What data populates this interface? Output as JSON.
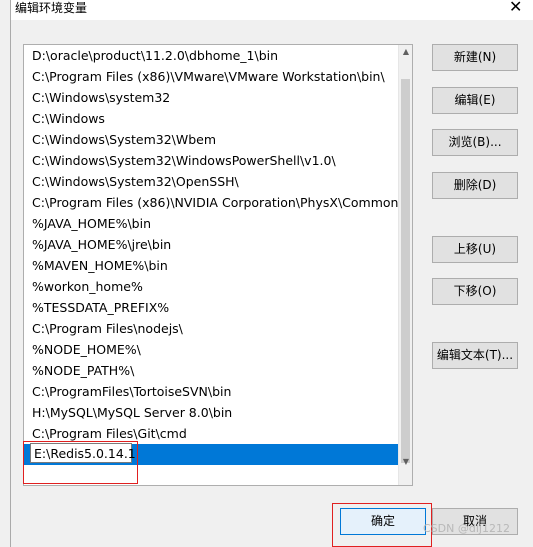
{
  "window": {
    "title": "编辑环境变量",
    "close_glyph": "✕"
  },
  "background_chars": [
    "变",
    "A",
    "C",
    "J",
    "M",
    "S",
    "T",
    "T",
    "U",
    "D",
    "",
    "",
    "",
    "",
    "",
    "",
    "",
    "",
    "",
    "",
    "",
    "",
    "",
    "",
    "",
    "",
    "",
    "",
    "",
    "",
    "",
    "",
    "",
    "",
    "",
    "",
    "",
    "",
    "",
    "",
    "",
    "",
    "",
    "",
    ""
  ],
  "path_entries": [
    "D:\\oracle\\product\\11.2.0\\dbhome_1\\bin",
    "C:\\Program Files (x86)\\VMware\\VMware Workstation\\bin\\",
    "C:\\Windows\\system32",
    "C:\\Windows",
    "C:\\Windows\\System32\\Wbem",
    "C:\\Windows\\System32\\WindowsPowerShell\\v1.0\\",
    "C:\\Windows\\System32\\OpenSSH\\",
    "C:\\Program Files (x86)\\NVIDIA Corporation\\PhysX\\Common",
    "%JAVA_HOME%\\bin",
    "%JAVA_HOME%\\jre\\bin",
    "%MAVEN_HOME%\\bin",
    "%workon_home%",
    "%TESSDATA_PREFIX%",
    "C:\\Program Files\\nodejs\\",
    "%NODE_HOME%\\",
    "%NODE_PATH%\\",
    "C:\\ProgramFiles\\TortoiseSVN\\bin",
    "H:\\MySQL\\MySQL Server 8.0\\bin",
    "C:\\Program Files\\Git\\cmd"
  ],
  "editing_entry": "E:\\Redis5.0.14.1",
  "buttons": {
    "new": "新建(N)",
    "edit": "编辑(E)",
    "browse": "浏览(B)...",
    "delete": "删除(D)",
    "move_up": "上移(U)",
    "move_down": "下移(O)",
    "edit_text": "编辑文本(T)...",
    "ok": "确定",
    "cancel": "取消"
  },
  "watermark": "CSDN @dlj1212",
  "colors": {
    "selection": "#0078d7",
    "highlight_box": "#e02020"
  }
}
